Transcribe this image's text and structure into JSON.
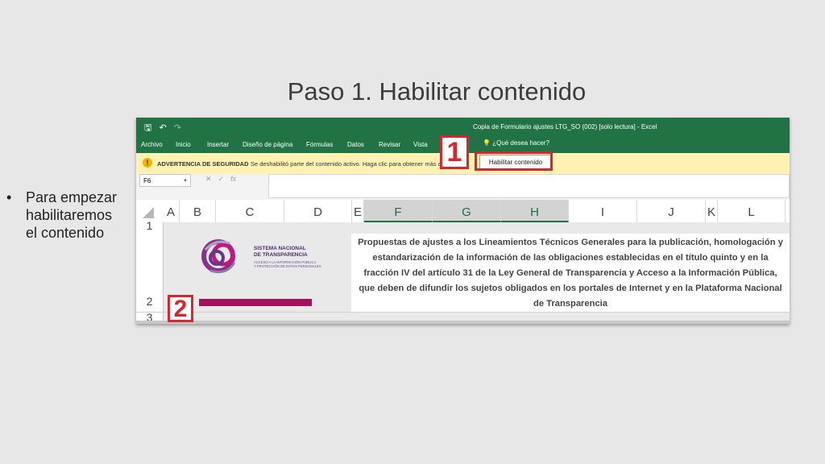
{
  "slide": {
    "title": "Paso 1. Habilitar contenido",
    "bullet_text": "Para empezar habilitaremos el contenido"
  },
  "excel": {
    "window_title": "Copia de Formulario ajustes LTG_SO (002)  [solo lectura]  -  Excel",
    "ribbon_tabs": [
      "Archivo",
      "Inicio",
      "Insertar",
      "Diseño de página",
      "Fórmulas",
      "Datos",
      "Revisar",
      "Vista"
    ],
    "tell_me": "¿Qué desea hacer?",
    "security_bar": {
      "label": "ADVERTENCIA DE SEGURIDAD",
      "message": "Se deshabilitó parte del contenido activo. Haga clic para obtener más detalles.",
      "button": "Habilitar contenido"
    },
    "name_box": "F6",
    "fx_symbol": "fx",
    "columns": [
      "A",
      "B",
      "C",
      "D",
      "E",
      "F",
      "G",
      "H",
      "I",
      "J",
      "K",
      "L"
    ],
    "selected_columns": [
      "F",
      "G",
      "H"
    ],
    "rows": [
      "1",
      "2",
      "3"
    ],
    "logo": {
      "title_line1": "SISTEMA NACIONAL",
      "title_line2": "DE TRANSPARENCIA",
      "sub_line1": "ACCESO A LA INFORMACIÓN PÚBLICA",
      "sub_line2": "Y PROTECCIÓN DE DATOS PERSONALES"
    },
    "notice": "Propuestas de ajustes a los Lineamientos Técnicos Generales para la publicación, homologación y estandarización de la información de las obligaciones establecidas en el título quinto y en la fracción IV del artículo 31 de la Ley General de Transparencia y Acceso a la Información Pública, que deben de difundir los sujetos obligados en los portales de Internet y en la Plataforma Nacional de Transparencia"
  },
  "annotations": {
    "step1": "1",
    "step2": "2"
  },
  "colors": {
    "excel_green": "#217346",
    "security_bar": "#fff2b3",
    "annotation_red": "#d6262e",
    "magenta_bar": "#a4125e"
  },
  "icons": [
    "save-icon",
    "undo-icon",
    "redo-icon",
    "lightbulb-icon",
    "warning-icon",
    "cancel-icon",
    "check-icon"
  ]
}
